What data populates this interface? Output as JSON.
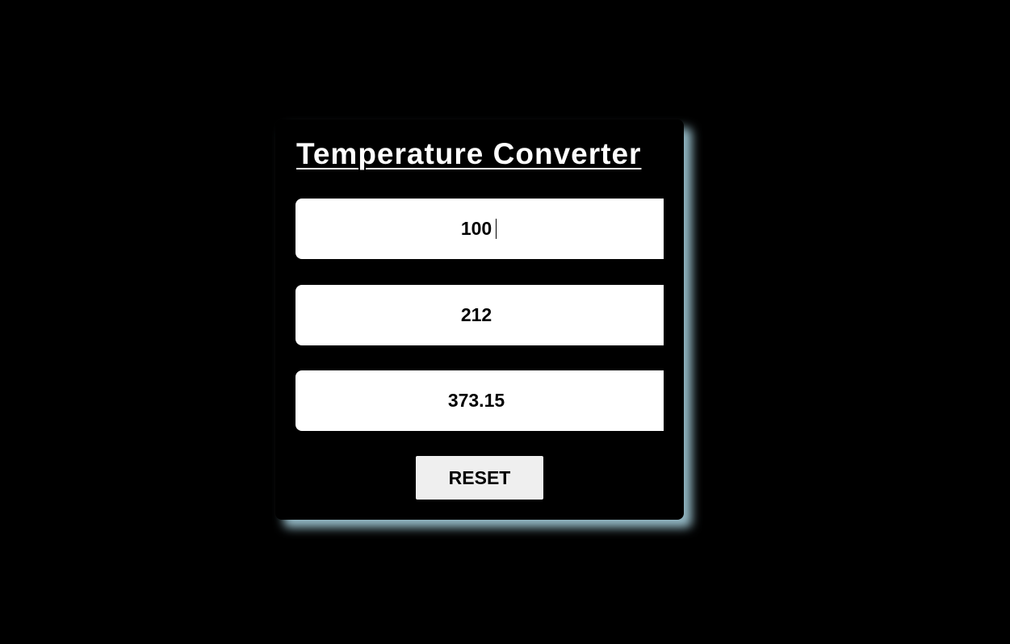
{
  "converter": {
    "title": "Temperature Converter",
    "celsius_value": "100",
    "fahrenheit_value": "212",
    "kelvin_value": "373.15",
    "reset_label": "RESET"
  },
  "colors": {
    "background": "#000000",
    "card": "#000000",
    "glow": "#add8e6",
    "input_bg": "#ffffff",
    "button_bg": "#efefef"
  }
}
